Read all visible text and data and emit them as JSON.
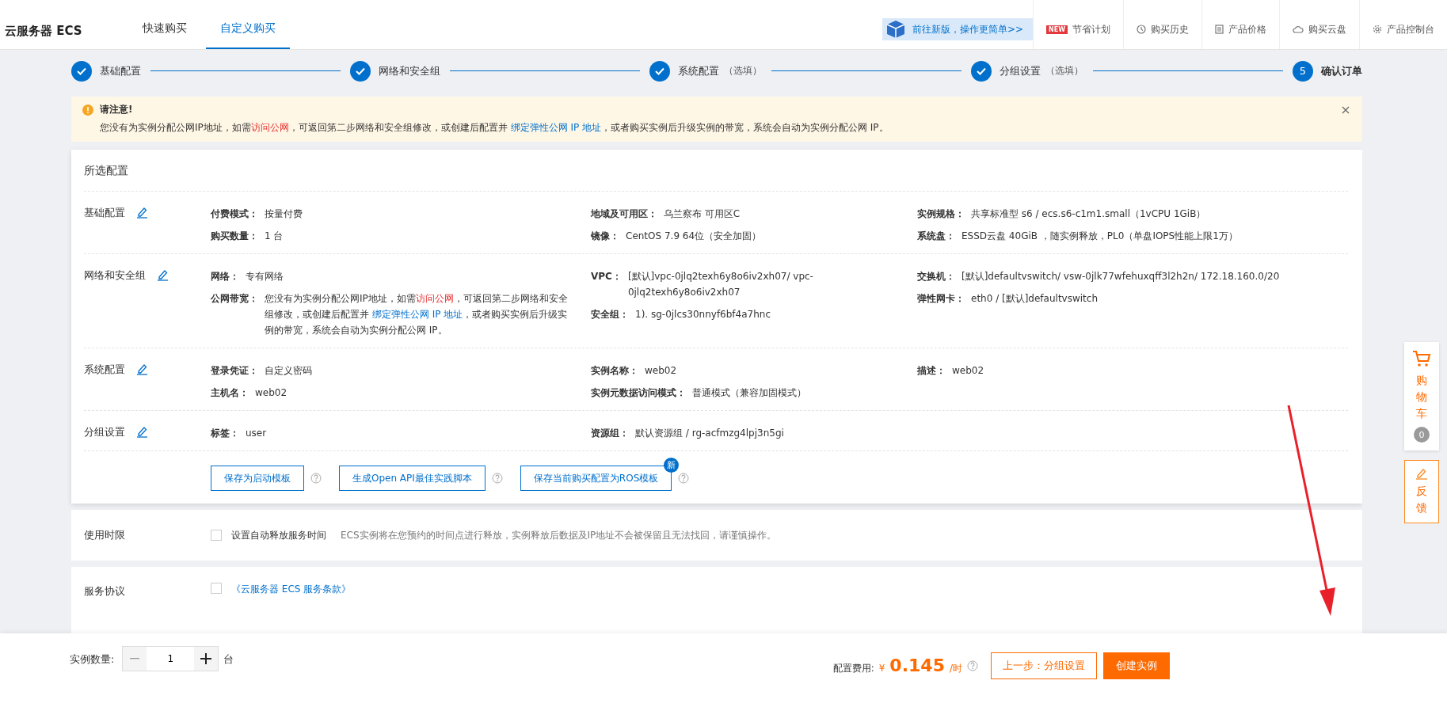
{
  "header": {
    "product": "云服务器 ECS",
    "tabs": [
      {
        "label": "快速购买",
        "selected": false
      },
      {
        "label": "自定义购买",
        "selected": true
      }
    ],
    "banner": "前往新版，操作更简单>>",
    "links": [
      {
        "kind": "new",
        "badge": "NEW",
        "label": "节省计划"
      },
      {
        "kind": "clock",
        "label": "购买历史"
      },
      {
        "kind": "list",
        "label": "产品价格"
      },
      {
        "kind": "cloud",
        "label": "购买云盘"
      },
      {
        "kind": "gear",
        "label": "产品控制台"
      }
    ]
  },
  "steps": [
    {
      "label": "基础配置",
      "done": true
    },
    {
      "label": "网络和安全组",
      "done": true
    },
    {
      "label": "系统配置",
      "note": "（选填）",
      "done": true
    },
    {
      "label": "分组设置",
      "note": "（选填）",
      "done": true
    },
    {
      "label": "确认订单",
      "number": "5",
      "done": false
    }
  ],
  "notice": {
    "title": "请注意!",
    "segments": [
      {
        "kind": "text",
        "text": "您没有为实例分配公网IP地址，如需"
      },
      {
        "kind": "warn-link",
        "text": "访问公网"
      },
      {
        "kind": "text",
        "text": "，可返回第二步网络和安全组修改，或创建后配置并 "
      },
      {
        "kind": "link",
        "text": "绑定弹性公网 IP 地址"
      },
      {
        "kind": "text",
        "text": "，或者购买实例后升级实例的带宽，系统会自动为实例分配公网 IP。"
      }
    ]
  },
  "summary": {
    "title": "所选配置",
    "sections": [
      {
        "title": "基础配置",
        "columns": [
          [
            {
              "label": "付费模式：",
              "value": "按量付费"
            },
            {
              "label": "购买数量：",
              "value": "1 台"
            }
          ],
          [
            {
              "label": "地域及可用区：",
              "value": "乌兰察布 可用区C"
            },
            {
              "label": "镜像：",
              "value": "CentOS 7.9 64位（安全加固）"
            }
          ],
          [
            {
              "label": "实例规格：",
              "value": "共享标准型 s6 / ecs.s6-c1m1.small（1vCPU 1GiB）"
            },
            {
              "label": "系统盘：",
              "value": "ESSD云盘 40GiB ，随实例释放，PL0（单盘IOPS性能上限1万）"
            }
          ]
        ]
      },
      {
        "title": "网络和安全组",
        "columns": [
          [
            {
              "label": "网络：",
              "value": "专有网络"
            },
            {
              "label": "公网带宽：",
              "segments": [
                {
                  "kind": "text",
                  "text": "您没有为实例分配公网IP地址，如需"
                },
                {
                  "kind": "warn-link",
                  "text": "访问公网"
                },
                {
                  "kind": "text",
                  "text": "，可返回第二步网络和安全组修改，或创建后配置并 "
                },
                {
                  "kind": "link",
                  "text": "绑定弹性公网 IP 地址"
                },
                {
                  "kind": "text",
                  "text": "，或者购买实例后升级实例的带宽，系统会自动为实例分配公网 IP。"
                }
              ]
            }
          ],
          [
            {
              "label": "VPC：",
              "value": "[默认]vpc-0jlq2texh6y8o6iv2xh07/ vpc-0jlq2texh6y8o6iv2xh07"
            },
            {
              "label": "安全组：",
              "value": "1). sg-0jlcs30nnyf6bf4a7hnc"
            }
          ],
          [
            {
              "label": "交换机：",
              "value": "[默认]defaultvswitch/ vsw-0jlk77wfehuxqff3l2h2n/ 172.18.160.0/20"
            },
            {
              "label": "弹性网卡：",
              "value": "eth0 / [默认]defaultvswitch"
            }
          ]
        ]
      },
      {
        "title": "系统配置",
        "columns": [
          [
            {
              "label": "登录凭证：",
              "value": "自定义密码"
            },
            {
              "label": "主机名：",
              "value": "web02"
            }
          ],
          [
            {
              "label": "实例名称：",
              "value": "web02"
            },
            {
              "label": "实例元数据访问模式：",
              "value": "普通模式（兼容加固模式）"
            }
          ],
          [
            {
              "label": "描述：",
              "value": "web02"
            }
          ]
        ]
      },
      {
        "title": "分组设置",
        "columns": [
          [
            {
              "label": "标签：",
              "value": "user"
            }
          ],
          [
            {
              "label": "资源组：",
              "value": "默认资源组 / rg-acfmzg4lpj3n5gi"
            }
          ],
          []
        ]
      }
    ],
    "actions": [
      {
        "label": "保存为启动模板"
      },
      {
        "label": "生成Open API最佳实践脚本"
      },
      {
        "label": "保存当前购买配置为ROS模板",
        "badge": "新"
      }
    ]
  },
  "usage": {
    "title": "使用时限",
    "option": "设置自动释放服务时间",
    "checked": false,
    "hint": "ECS实例将在您预约的时间点进行释放，实例释放后数据及IP地址不会被保留且无法找回，请谨慎操作。"
  },
  "agreement": {
    "title": "服务协议",
    "link": "《云服务器 ECS 服务条款》",
    "checked": false
  },
  "float": {
    "cart": "购物车",
    "cart_count": "0",
    "feedback": "反馈"
  },
  "footer": {
    "quantity_label": "实例数量:",
    "quantity": "1",
    "unit": "台",
    "fee_label": "配置费用:",
    "currency": "¥",
    "price": "0.145",
    "per": "/时",
    "prev": "上一步：分组设置",
    "create": "创建实例"
  }
}
